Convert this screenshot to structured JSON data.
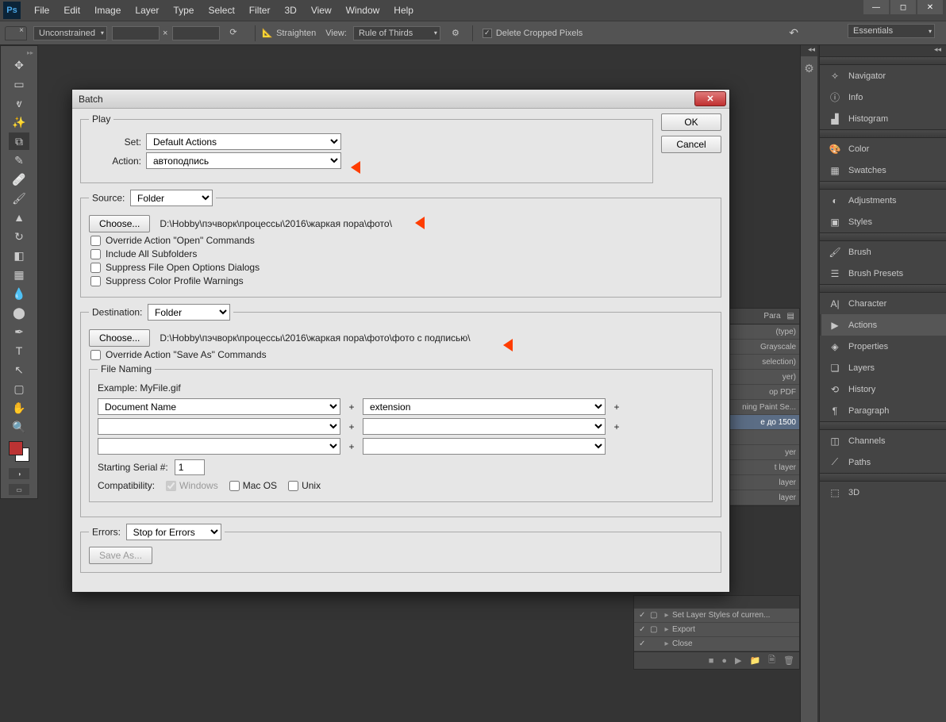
{
  "menu": [
    "File",
    "Edit",
    "Image",
    "Layer",
    "Type",
    "Select",
    "Filter",
    "3D",
    "View",
    "Window",
    "Help"
  ],
  "workspace": "Essentials",
  "options": {
    "constraint": "Unconstrained",
    "straighten": "Straighten",
    "viewLabel": "View:",
    "viewVal": "Rule of Thirds",
    "deleteCropped": "Delete Cropped Pixels"
  },
  "rightPanels": {
    "g1": [
      "Navigator",
      "Info",
      "Histogram"
    ],
    "g2": [
      "Color",
      "Swatches"
    ],
    "g3": [
      "Adjustments",
      "Styles"
    ],
    "g4": [
      "Brush",
      "Brush Presets"
    ],
    "g5": [
      "Character",
      "Actions",
      "Properties",
      "Layers",
      "History",
      "Paragraph"
    ],
    "g6": [
      "Channels",
      "Paths"
    ],
    "g7": [
      "3D"
    ]
  },
  "behindPanel": {
    "tab": "Para",
    "rows": [
      "(type)",
      "Grayscale",
      "selection)",
      "yer)",
      "op PDF",
      "ning Paint Se...",
      "е до 1500",
      "",
      "yer",
      "t layer",
      "layer",
      "layer"
    ]
  },
  "bottomPanel": {
    "rows": [
      "Set Layer Styles of curren...",
      "Export",
      "Close"
    ]
  },
  "dialog": {
    "title": "Batch",
    "ok": "OK",
    "cancel": "Cancel",
    "play": {
      "legend": "Play",
      "setLabel": "Set:",
      "setVal": "Default Actions",
      "actionLabel": "Action:",
      "actionVal": "автоподпись"
    },
    "source": {
      "label": "Source:",
      "val": "Folder",
      "choose": "Choose...",
      "path": "D:\\Hobby\\пэчворк\\процессы\\2016\\жаркая пора\\фото\\",
      "cb1": "Override Action \"Open\" Commands",
      "cb2": "Include All Subfolders",
      "cb3": "Suppress File Open Options Dialogs",
      "cb4": "Suppress Color Profile Warnings"
    },
    "dest": {
      "label": "Destination:",
      "val": "Folder",
      "choose": "Choose...",
      "path": "D:\\Hobby\\пэчворк\\процессы\\2016\\жаркая пора\\фото\\фото с подписью\\",
      "cb": "Override Action \"Save As\" Commands",
      "fnLegend": "File Naming",
      "example": "Example: MyFile.gif",
      "f1": "Document Name",
      "f2": "extension",
      "serialLabel": "Starting Serial #:",
      "serialVal": "1",
      "compatLabel": "Compatibility:",
      "cWin": "Windows",
      "cMac": "Mac OS",
      "cUnix": "Unix"
    },
    "errors": {
      "label": "Errors:",
      "val": "Stop for Errors",
      "saveAs": "Save As..."
    }
  }
}
